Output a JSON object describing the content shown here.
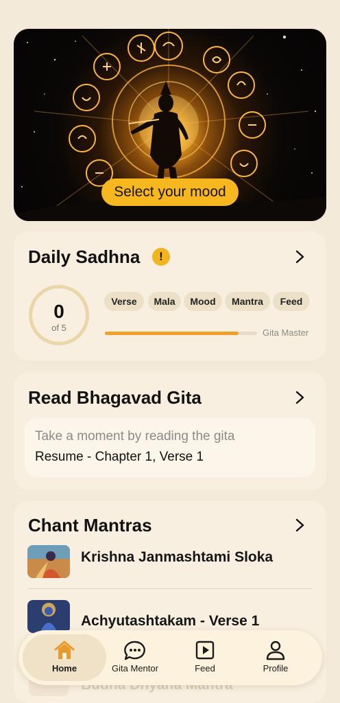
{
  "hero": {
    "mood_button": "Select your mood"
  },
  "daily_sadhna": {
    "title": "Daily Sadhna",
    "alert": "!",
    "completed": "0",
    "of_label": "of 5",
    "chips": [
      "Verse",
      "Mala",
      "Mood",
      "Mantra",
      "Feed"
    ],
    "progress": 0.88,
    "progress_label": "Gita Master"
  },
  "read_gita": {
    "title": "Read Bhagavad Gita",
    "hint": "Take a moment by reading the gita",
    "resume": "Resume - Chapter 1, Verse 1"
  },
  "chant_mantras": {
    "title": "Chant Mantras",
    "items": [
      {
        "title": "Krishna Janmashtami Sloka"
      },
      {
        "title": "Achyutashtakam - Verse 1"
      },
      {
        "title": "Budha Dhyana Mantra"
      }
    ]
  },
  "nav": {
    "items": [
      {
        "label": "Home",
        "icon": "home-icon"
      },
      {
        "label": "Gita Mentor",
        "icon": "chat-icon"
      },
      {
        "label": "Feed",
        "icon": "play-icon"
      },
      {
        "label": "Profile",
        "icon": "user-icon"
      }
    ]
  },
  "colors": {
    "accent": "#f6b81e",
    "background": "#f3ead9",
    "card": "#f8efe0"
  }
}
